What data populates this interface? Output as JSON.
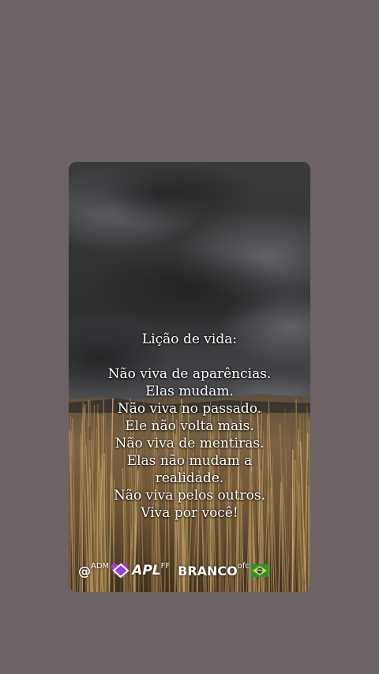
{
  "poem": {
    "title": "Lição de vida:",
    "lines": [
      "Não viva de aparências.",
      "Elas mudam.",
      "Não viva no passado.",
      "Ele não volta mais.",
      "Não viva de mentiras.",
      "Elas não mudam a",
      "realidade.",
      "Não viva pelos outros.",
      "Viva por você!"
    ]
  },
  "signature": {
    "at": "@",
    "adm": "ADM",
    "apl": "APL",
    "ff": "FF",
    "branco": "BRANCO",
    "ofc": "ofc"
  },
  "colors": {
    "page_background": "#6d6367",
    "sky_dark": "#2f3032",
    "sky_light": "#6b6d70",
    "field_gold": "#8a6a3a",
    "heart_purple": "#9b3fd6",
    "text": "#ffffff"
  }
}
